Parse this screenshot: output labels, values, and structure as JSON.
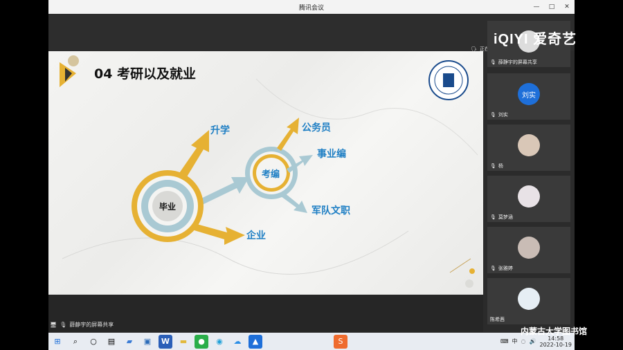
{
  "window": {
    "title": "腾讯会议",
    "controls": [
      "—",
      "□",
      "✕"
    ]
  },
  "speaking": {
    "prefix": "正在讲"
  },
  "slide": {
    "title": "04 考研以及就业",
    "center_label": "毕业",
    "sub_center_label": "考编",
    "branches": {
      "further_study": "升学",
      "enterprise": "企业"
    },
    "sub_branches": {
      "civil_servant": "公务员",
      "public_institution": "事业编",
      "military": "军队文职"
    },
    "colors": {
      "gold": "#e6b133",
      "teal": "#a9c9d3",
      "blue_text": "#1f7fc4"
    }
  },
  "sharer": {
    "label": "薛静宇的屏幕共享"
  },
  "participants": [
    {
      "name": "薛静宇的屏幕共享",
      "avatar": ""
    },
    {
      "name": "刘实",
      "avatar": "刘实",
      "color": "#1e6fd9"
    },
    {
      "name": "杨",
      "avatar": ""
    },
    {
      "name": "莫梦涵",
      "avatar": ""
    },
    {
      "name": "张雅婷",
      "avatar": ""
    },
    {
      "name": "陈希茜",
      "avatar": ""
    }
  ],
  "taskbar": {
    "icons": [
      "windows-start",
      "search",
      "task-view",
      "widgets",
      "files",
      "store",
      "word",
      "explorer",
      "wechat",
      "edge",
      "baidu-netdisk",
      "tencent-meeting",
      "sogou"
    ],
    "tray": {
      "ime": "中",
      "time": "14:58",
      "date": "2022-10-19"
    }
  },
  "watermarks": {
    "brand": "iQIYI 爱奇艺",
    "library": "内蒙古大学图书馆"
  }
}
